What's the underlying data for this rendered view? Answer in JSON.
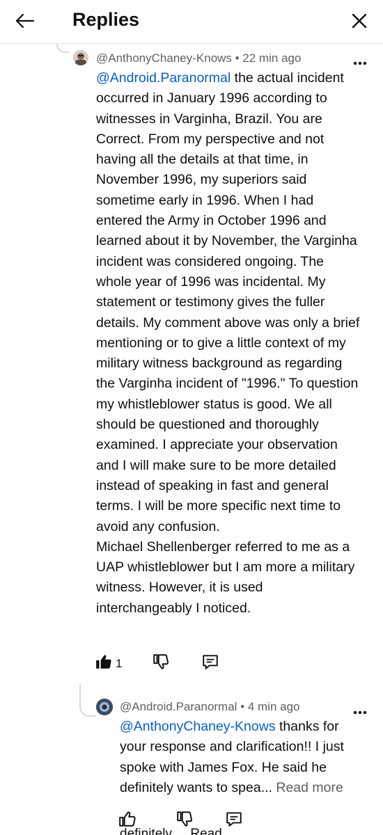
{
  "header": {
    "title": "Replies"
  },
  "reply1": {
    "author": "@AnthonyChaney-Knows",
    "separator": "•",
    "time": "22 min ago",
    "mention": "@Android.Paranormal",
    "text": " the actual incident occurred in January 1996 according to witnesses in Varginha, Brazil. You are Correct. From my perspective and not having all the details at that time, in November 1996, my superiors said sometime early in 1996. When I had entered the Army in October 1996 and learned about it by November, the Varginha incident was considered ongoing. The whole year of 1996 was incidental. My statement or testimony gives the fuller details. My comment above was only a brief mentioning or to give a little context of my military witness background as regarding the Varginha incident of \"1996.\" To question my whistleblower status is good. We all should be questioned and thoroughly examined. I appreciate your observation and I will make sure to be more detailed instead of speaking in fast and general terms. I will be more specific next time to avoid any confusion.\nMichael Shellenberger referred to me as a UAP whistleblower but I am more a military witness. However, it is used interchangeably I noticed.",
    "like_count": "1",
    "liked": true
  },
  "reply2": {
    "author": "@Android.Paranormal",
    "separator": "•",
    "time": "4 min ago",
    "mention": "@AnthonyChaney-Knows",
    "text": " thanks for your response and clarification!! I just spoke with James Fox. He said he definitely wants to spea... ",
    "read_more": "Read more",
    "liked": false
  },
  "next_partial_text": "definitely ... Read",
  "colors": {
    "link": "#065fd4",
    "meta": "#606060",
    "text": "#0f0f0f",
    "divider": "#e5e5e5"
  },
  "icons": {
    "back": "back-arrow-icon",
    "close": "close-icon",
    "more": "more-vert-icon",
    "like": "thumb-up-icon",
    "dislike": "thumb-down-icon",
    "reply": "comment-icon"
  }
}
